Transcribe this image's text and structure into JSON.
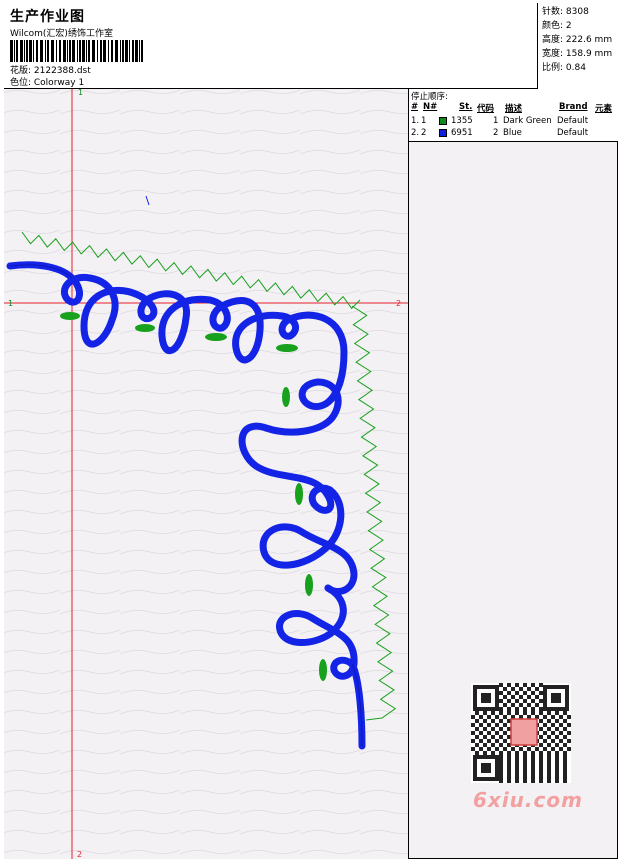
{
  "header": {
    "title": "生产作业图",
    "company": "Wilcom(汇宏)绣饰工作室",
    "design": "花版: 2122388.dst",
    "colorway": "色位: Colorway 1"
  },
  "stats": [
    {
      "label": "针数",
      "value": "8308"
    },
    {
      "label": "颜色",
      "value": "2"
    },
    {
      "label": "高度",
      "value": "222.6 mm"
    },
    {
      "label": "宽度",
      "value": "158.9 mm"
    },
    {
      "label": "比例",
      "value": "0.84"
    }
  ],
  "stop_sequence": {
    "title": "停止顺序:",
    "columns": [
      "#",
      "N#",
      "St.",
      "代码",
      "描述",
      "Brand",
      "元素"
    ],
    "rows": [
      {
        "num": "1.",
        "n": "1",
        "st": "1355",
        "code": "1",
        "desc": "Dark Green",
        "brand": "Default",
        "color": "#0f8a1a"
      },
      {
        "num": "2.",
        "n": "2",
        "st": "6951",
        "code": "2",
        "desc": "Blue",
        "brand": "Default",
        "color": "#1020e0"
      }
    ]
  },
  "axes": {
    "v_top": "1",
    "v_bottom": "2",
    "h_left": "1",
    "h_right": "2"
  },
  "colors": {
    "green": "#17a11c",
    "blue": "#1424e6",
    "axis": "#e4202c"
  },
  "watermark": {
    "text": "6xiu.com",
    "stamp": "汇宏\n图库"
  }
}
